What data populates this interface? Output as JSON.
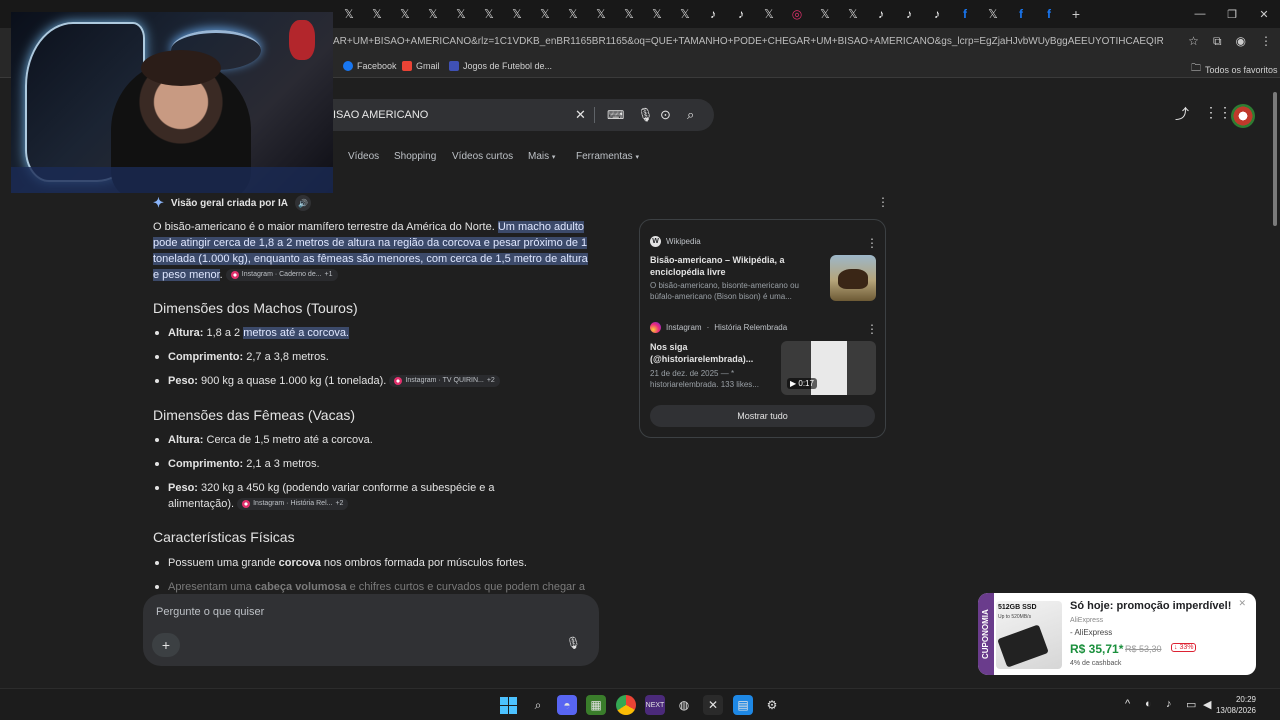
{
  "browser": {
    "url": "AR+UM+BISAO+AMERICANO&rlz=1C1VDKB_enBR1165BR1165&oq=QUE+TAMANHO+PODE+CHEGAR+UM+BISAO+AMERICANO&gs_lcrp=EgZjaHJvbWUyBggAEEUYOTIHCAEQIRigAdIBCTEzNDQ0aj...",
    "bookmarks": [
      "Facebook",
      "Gmail",
      "Jogos de Futebol de..."
    ],
    "favorites_label": "Todos os favoritos"
  },
  "search": {
    "query": "ISAO AMERICANO",
    "tabs": [
      "Vídeos",
      "Shopping",
      "Vídeos curtos",
      "Mais",
      "Ferramentas"
    ]
  },
  "ai_overview": {
    "header": "Visão geral criada por IA",
    "intro_plain": "O bisão-americano é o maior mamífero terrestre da América do Norte. ",
    "intro_highlight": "Um macho adulto pode atingir cerca de 1,8 a 2 metros de altura na região da corcova e pesar próximo de 1 tonelada (1.000 kg), enquanto as fêmeas são menores, com cerca de 1,5 metro de altura e peso menor",
    "intro_end": ".",
    "intro_chip": "Instagram · Caderno de...",
    "intro_chip_count": "+1",
    "males_heading": "Dimensões dos Machos (Touros)",
    "males": [
      {
        "label": "Altura:",
        "pre": " 1,8 a 2 ",
        "hl": "metros até a corcova.",
        "text": ""
      },
      {
        "label": "Comprimento:",
        "text": " 2,7 a 3,8 metros."
      },
      {
        "label": "Peso:",
        "text": " 900 kg a quase 1.000 kg (1 tonelada).",
        "chip": "Instagram · TV QUIRIN...",
        "chip_count": "+2"
      }
    ],
    "females_heading": "Dimensões das Fêmeas (Vacas)",
    "females": [
      {
        "label": "Altura:",
        "text": " Cerca de 1,5 metro até a corcova."
      },
      {
        "label": "Comprimento:",
        "text": " 2,1 a 3 metros."
      },
      {
        "label": "Peso:",
        "text": " 320 kg a 450 kg (podendo variar conforme a subespécie e a",
        "text2": "alimentação).",
        "chip": "Instagram · História Rel...",
        "chip_count": "+2"
      }
    ],
    "phys_heading": "Características Físicas",
    "phys": [
      {
        "pre": "Possuem uma grande ",
        "bold": "corcova",
        "post": " nos ombros formada por músculos fortes."
      },
      {
        "pre": "Apresentam uma ",
        "bold": "cabeça volumosa",
        "post": " e chifres curtos e curvados que podem chegar a"
      }
    ]
  },
  "sources": {
    "wiki": {
      "site": "Wikipedia",
      "title": "Bisão-americano – Wikipédia, a enciclopédia livre",
      "snippet": "O bisão-americano, bisonte-americano ou búfalo-americano (Bison bison) é uma..."
    },
    "insta": {
      "site": "Instagram",
      "account": "História Relembrada",
      "title": "Nos siga (@historiarelembrada)...",
      "snippet": "21 de dez. de 2025 — * historiarelembrada. 133 likes...",
      "duration": "0:17"
    },
    "show_all": "Mostrar tudo"
  },
  "ask": {
    "placeholder": "Pergunte o que quiser"
  },
  "ad": {
    "band": "CUPONOMIA",
    "title": "Só hoje: promoção imperdível!",
    "seller_small": "AliExpress",
    "seller": "- AliExpress",
    "price": "R$ 35,71*",
    "old_price": "R$ 53,30",
    "discount": "↓ 33%",
    "cashback": "4% de cashback",
    "img_text": "512GB SSD",
    "img_sub": "Up to 520MB/s"
  },
  "taskbar": {
    "time": "20:29",
    "date": "13/08/2026"
  }
}
